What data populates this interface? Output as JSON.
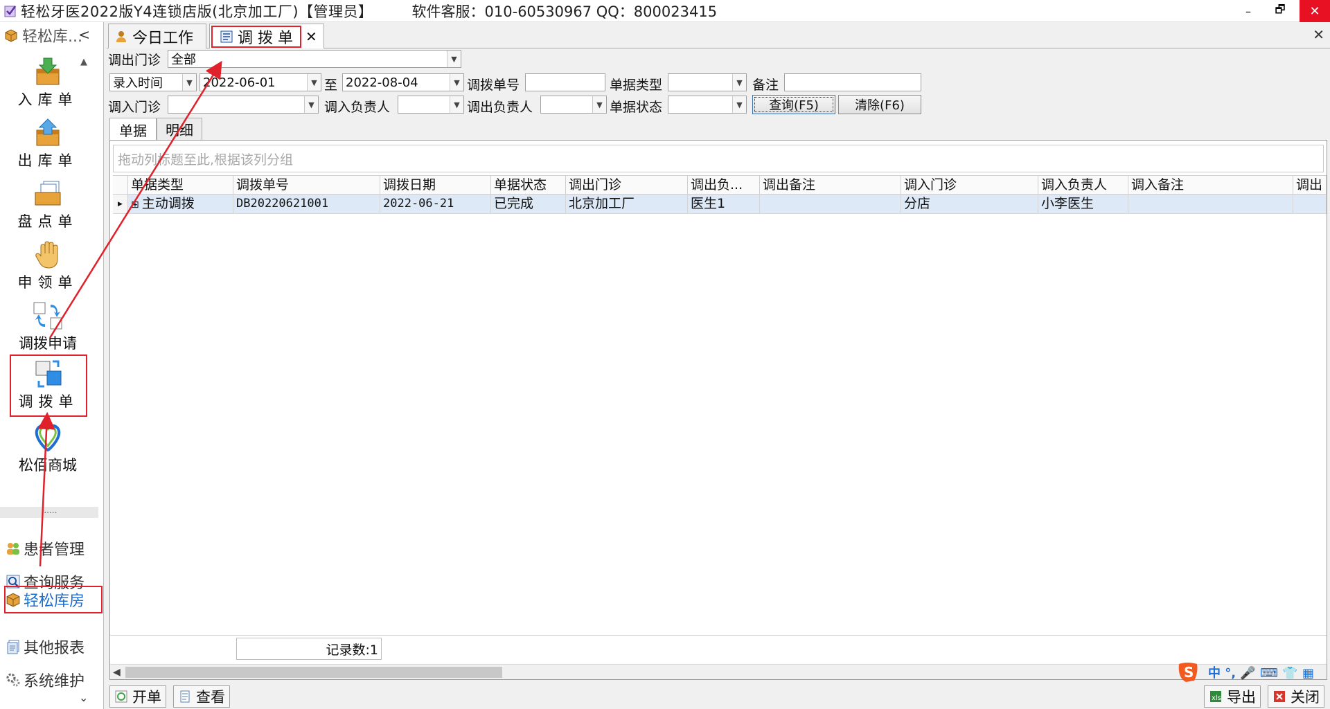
{
  "window": {
    "title": "轻松牙医2022版Y4连锁店版(北京加工厂)【管理员】",
    "support": "软件客服：010-60530967 QQ：800023415",
    "minimize_glyph": "–",
    "restore_glyph": "🗗",
    "close_glyph": "✕"
  },
  "leftnav": {
    "header": "轻松库...",
    "collapse_glyph": "<",
    "items": [
      {
        "label": "入库单"
      },
      {
        "label": "出库单"
      },
      {
        "label": "盘点单"
      },
      {
        "label": "申领单"
      },
      {
        "label": "调拨申请"
      },
      {
        "label": "调拨单"
      },
      {
        "label": "松佰商城"
      }
    ],
    "separator": "......",
    "sections": [
      {
        "label": "患者管理"
      },
      {
        "label": "查询服务"
      },
      {
        "label": "轻松库房"
      },
      {
        "label": "其他报表"
      },
      {
        "label": "系统维护"
      }
    ]
  },
  "tabs": [
    {
      "label": "今日工作"
    },
    {
      "label": "调 拨 单"
    }
  ],
  "tab_close_glyph": "✕",
  "filter": {
    "out_clinic_label": "调出门诊",
    "out_clinic_value": "全部",
    "time_type_value": "录入时间",
    "date_from": "2022-06-01",
    "to_label": "至",
    "date_to": "2022-08-04",
    "transfer_no_label": "调拨单号",
    "doc_type_label": "单据类型",
    "remark_label": "备注",
    "in_clinic_label": "调入门诊",
    "in_person_label": "调入负责人",
    "out_person_label": "调出负责人",
    "doc_status_label": "单据状态",
    "query_button": "查询(F5)",
    "clear_button": "清除(F6)"
  },
  "subtabs": [
    {
      "label": "单据"
    },
    {
      "label": "明细"
    }
  ],
  "grid": {
    "group_hint": "拖动列标题至此,根据该列分组",
    "columns": [
      "单据类型",
      "调拨单号",
      "调拨日期",
      "单据状态",
      "调出门诊",
      "调出负...",
      "调出备注",
      "调入门诊",
      "调入负责人",
      "调入备注",
      "调出"
    ],
    "rows": [
      {
        "expand": "⊞",
        "type": "主动调拨",
        "no": "DB20220621001",
        "date": "2022-06-21",
        "status": "已完成",
        "out_clinic": "北京加工厂",
        "out_person": "医生1",
        "out_remark": "",
        "in_clinic": "分店",
        "in_person": "小李医生",
        "in_remark": ""
      }
    ],
    "record_count": "记录数:1"
  },
  "bottom": {
    "new_button": "开单",
    "view_button": "查看",
    "export_button": "导出",
    "close_button": "关闭"
  },
  "ime": {
    "mode": "中 °, 🎤 ⌨ 👕 ▦"
  },
  "colors": {
    "annotation_red": "#e0202a",
    "selected_row": "#dde9f6",
    "active_section": "#1a6fd1"
  }
}
